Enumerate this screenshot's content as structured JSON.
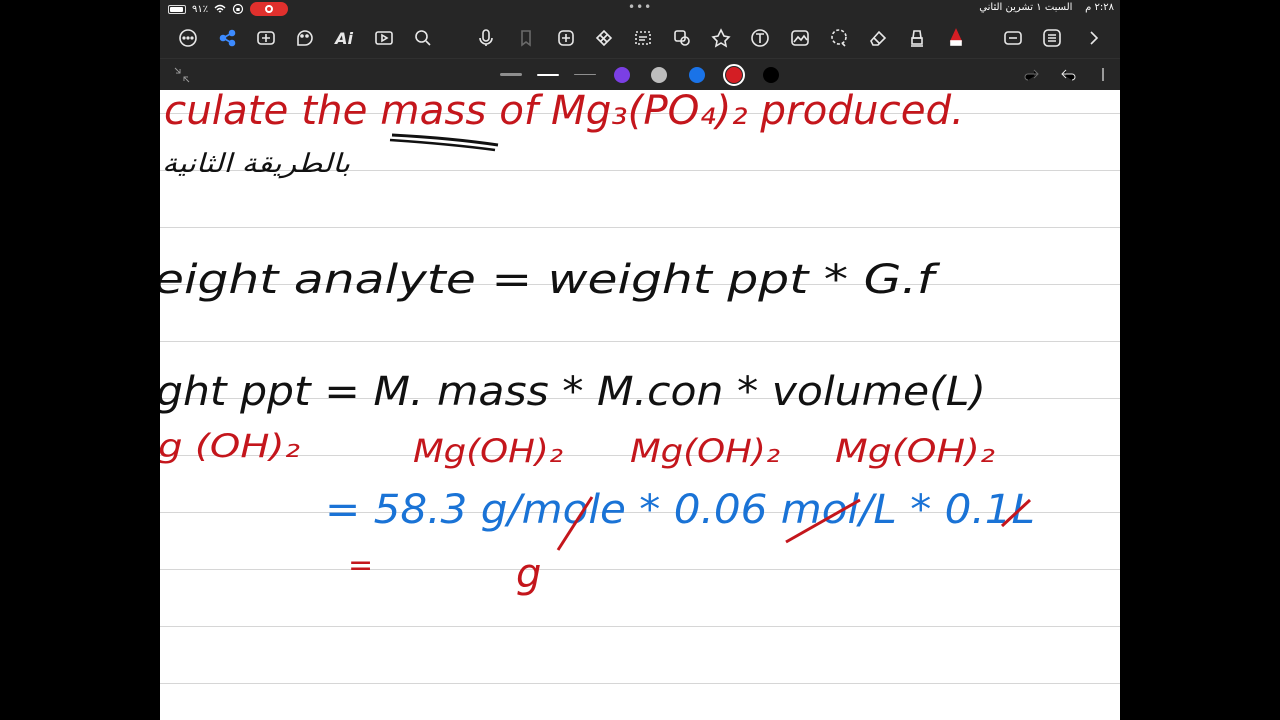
{
  "status_bar": {
    "time": "٢:٢٨ م",
    "date": "السبت ١ تشرين الثاني",
    "battery_percent": "٩١٪",
    "battery_level": 0.91
  },
  "toolbar": {
    "tools": [
      "more-icon",
      "share-icon",
      "text-plus-icon",
      "sticker-icon",
      "ai-icon",
      "media-icon",
      "search-icon",
      "mic-icon",
      "bookmark-icon",
      "lasso-add-icon",
      "crop-icon",
      "select-icon",
      "shapes-icon",
      "stamp-icon",
      "text-tool-icon",
      "image-tool-icon",
      "lasso-icon",
      "eraser-icon",
      "highlighter-icon",
      "pen-icon",
      "textbox-icon",
      "list-icon",
      "chevron-right-icon"
    ],
    "ai_label": "Ai"
  },
  "palette": {
    "colors": [
      "#7b3fe4",
      "#bdbdbd",
      "#1a73e8",
      "#d41e24",
      "#000000"
    ],
    "selected_color": "#d41e24"
  },
  "notes": {
    "line1": "culate the mass of Mg₃(PO₄)₂ produced.",
    "line2": "بالطريقة الثانية",
    "line3": "eight analyte = weight ppt * G.f",
    "line4": "ght ppt = M. mass * M.con * volume(L)",
    "line5a": "g (OH)₂",
    "line5b": "Mg(OH)₂",
    "line5c": "Mg(OH)₂",
    "line5d": "Mg(OH)₂",
    "line6": "= 58.3 g/mole * 0.06 mol/L * 0.1L",
    "line7a": "=",
    "line7b": "g"
  }
}
